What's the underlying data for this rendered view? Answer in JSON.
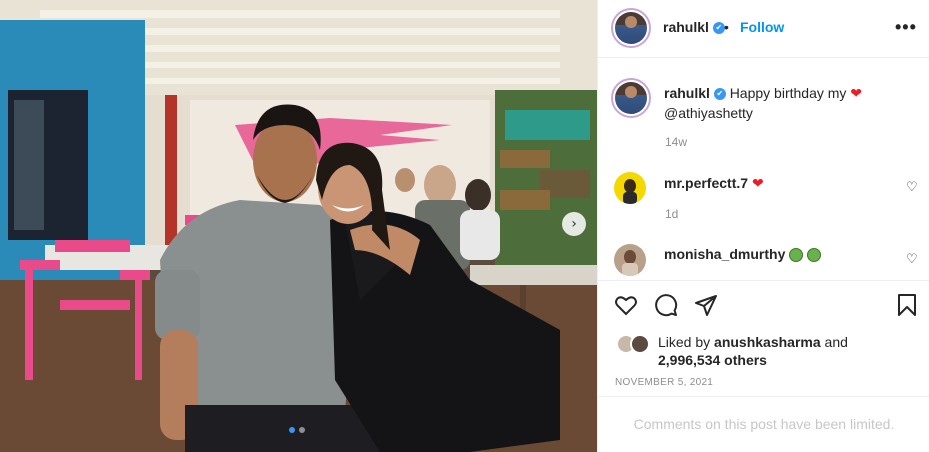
{
  "post": {
    "username": "rahulkl",
    "verified_mark": "✔",
    "bullet": "•",
    "follow_label": "Follow",
    "more_label": "•••",
    "caption_user": "rahulkl",
    "caption_text": "Happy birthday my",
    "caption_mention": "@athiyashetty",
    "caption_time": "14w",
    "heart_glyph": "❤"
  },
  "comments": [
    {
      "username": "mr.perfectt.7",
      "time": "1d",
      "has_heart": true
    },
    {
      "username": "monisha_dmurthy",
      "time": "",
      "emoji_count": 2
    }
  ],
  "likes": {
    "prefix": "Liked by",
    "user": "anushkasharma",
    "conj": "and",
    "others": "2,996,534 others"
  },
  "date": "NOVEMBER 5, 2021",
  "comments_limited": "Comments on this post have been limited.",
  "carousel": {
    "next_glyph": "›",
    "total_slides": 2,
    "active_slide": 1
  },
  "icons": [
    "heart-icon",
    "comment-icon",
    "share-icon",
    "save-icon",
    "more-options-icon",
    "carousel-next-icon"
  ],
  "colors": {
    "link_blue": "#0095f6",
    "verified_blue": "#3897f0",
    "heart_red": "#ed1c24",
    "muted": "#8e8e8e"
  }
}
